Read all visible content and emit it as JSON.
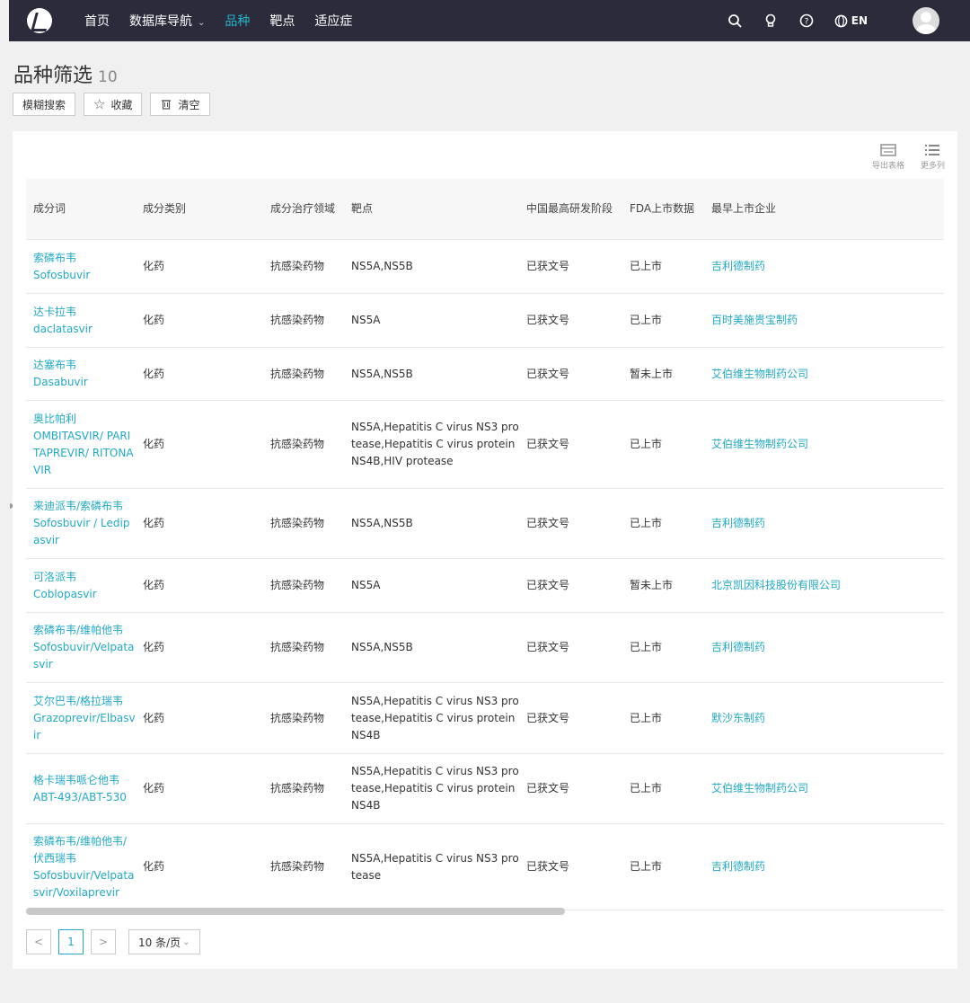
{
  "nav": {
    "items": [
      {
        "label": "首页"
      },
      {
        "label": "数据库导航"
      },
      {
        "label": "品种"
      },
      {
        "label": "靶点"
      },
      {
        "label": "适应症"
      }
    ],
    "lang": "EN"
  },
  "header": {
    "title": "品种筛选",
    "count": "10"
  },
  "toolbar": {
    "fuzzy": "模糊搜索",
    "favorite": "收藏",
    "clear": "清空"
  },
  "tools": {
    "export": "导出表格",
    "more_cols": "更多列"
  },
  "table": {
    "headers": [
      "成分词",
      "成分类别",
      "成分治疗领域",
      "靶点",
      "中国最高研发阶段",
      "FDA上市数据",
      "最早上市企业"
    ],
    "rows": [
      {
        "cn": "索磷布韦",
        "en": "Sofosbuvir",
        "cat": "化药",
        "area": "抗感染药物",
        "target": "NS5A,NS5B",
        "stage": "已获文号",
        "fda": "已上市",
        "company": "吉利德制药"
      },
      {
        "cn": "达卡拉韦",
        "en": "daclatasvir",
        "cat": "化药",
        "area": "抗感染药物",
        "target": "NS5A",
        "stage": "已获文号",
        "fda": "已上市",
        "company": "百时美施贵宝制药"
      },
      {
        "cn": "达塞布韦",
        "en": "Dasabuvir",
        "cat": "化药",
        "area": "抗感染药物",
        "target": "NS5A,NS5B",
        "stage": "已获文号",
        "fda": "暂未上市",
        "company": "艾伯维生物制药公司"
      },
      {
        "cn": "奥比帕利",
        "en": "OMBITASVIR/ PARITAPREVIR/ RITONAVIR",
        "cat": "化药",
        "area": "抗感染药物",
        "target": "NS5A,Hepatitis C virus NS3 protease,Hepatitis C virus protein NS4B,HIV protease",
        "stage": "已获文号",
        "fda": "已上市",
        "company": "艾伯维生物制药公司"
      },
      {
        "cn": "来迪派韦/索磷布韦",
        "en": "Sofosbuvir / Ledipasvir",
        "cat": "化药",
        "area": "抗感染药物",
        "target": "NS5A,NS5B",
        "stage": "已获文号",
        "fda": "已上市",
        "company": "吉利德制药"
      },
      {
        "cn": "可洛派韦",
        "en": "Coblopasvir",
        "cat": "化药",
        "area": "抗感染药物",
        "target": "NS5A",
        "stage": "已获文号",
        "fda": "暂未上市",
        "company": "北京凯因科技股份有限公司"
      },
      {
        "cn": "索磷布韦/维帕他韦",
        "en": "Sofosbuvir/Velpatasvir",
        "cat": "化药",
        "area": "抗感染药物",
        "target": "NS5A,NS5B",
        "stage": "已获文号",
        "fda": "已上市",
        "company": "吉利德制药"
      },
      {
        "cn": "艾尔巴韦/格拉瑞韦",
        "en": "Grazoprevir/Elbasvir",
        "cat": "化药",
        "area": "抗感染药物",
        "target": "NS5A,Hepatitis C virus NS3 protease,Hepatitis C virus protein NS4B",
        "stage": "已获文号",
        "fda": "已上市",
        "company": "默沙东制药"
      },
      {
        "cn": "格卡瑞韦哌仑他韦",
        "en": "ABT-493/ABT-530",
        "cat": "化药",
        "area": "抗感染药物",
        "target": "NS5A,Hepatitis C virus NS3 protease,Hepatitis C virus protein NS4B",
        "stage": "已获文号",
        "fda": "已上市",
        "company": "艾伯维生物制药公司"
      },
      {
        "cn": "索磷布韦/维帕他韦/伏西瑞韦",
        "en": "Sofosbuvir/Velpatasvir/Voxilaprevir",
        "cat": "化药",
        "area": "抗感染药物",
        "target": "NS5A,Hepatitis C virus NS3 protease",
        "stage": "已获文号",
        "fda": "已上市",
        "company": "吉利德制药"
      }
    ]
  },
  "pager": {
    "prev": "<",
    "current": "1",
    "next": ">",
    "size": "10 条/页"
  }
}
